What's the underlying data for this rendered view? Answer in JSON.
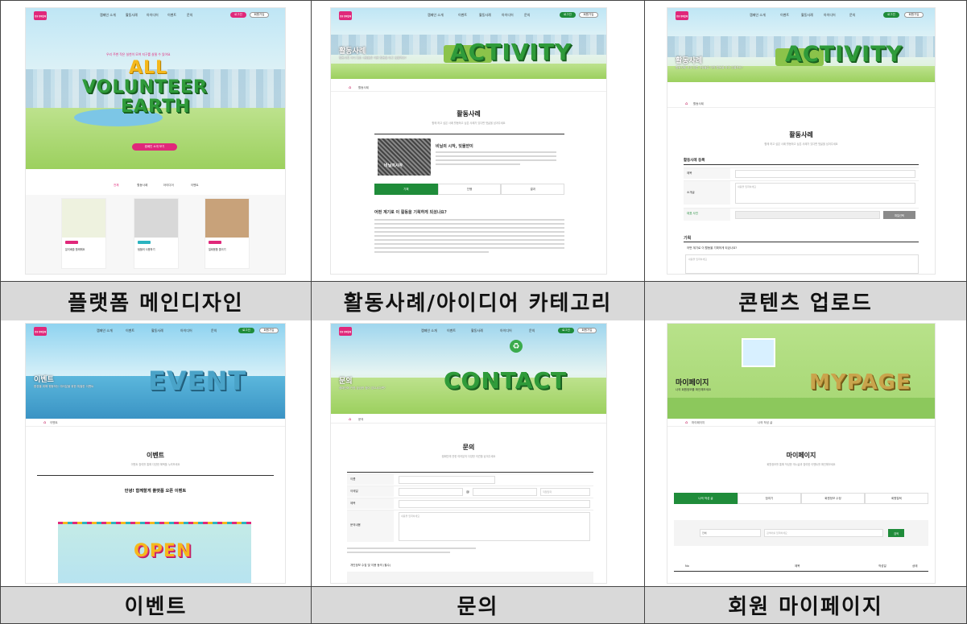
{
  "captions": [
    "플랫폼 메인디자인",
    "활동사례/아이디어 카테고리",
    "콘텐츠 업로드",
    "이벤트",
    "문의",
    "회원 마이페이지"
  ],
  "common": {
    "logo": "안녕 함께할께",
    "nav": [
      "캠페인 소개",
      "이벤트",
      "활동사례",
      "아이디어",
      "문의"
    ],
    "login": "로그인",
    "join": "회원가입",
    "home_icon": "home-icon"
  },
  "main": {
    "tagline": "우리 주변 작은 실천이 모여 지구를 살릴 수 있어요",
    "hero_lines": [
      "ALL",
      "VOLUNTEER",
      "EARTH"
    ],
    "cta": "캠페인 소개 보기",
    "tabs": [
      "전체",
      "활동사례",
      "아이디어",
      "이벤트"
    ],
    "cards": [
      {
        "tag": "활동사례",
        "title": "분리배출 함께해요"
      },
      {
        "tag": "아이디어",
        "title": "텀블러 사용하기"
      },
      {
        "tag": "활동사례",
        "title": "일회용품 줄이기"
      }
    ]
  },
  "activity": {
    "hero_title": "활동사례",
    "hero_sub": "활동사례 서식 다른 사람들은 어떤 활동을 하고 있을까요?",
    "hero_word": "ACTIVITY",
    "section": "활동사례",
    "section_sub": "함께 하고 싶은 사례 활동하고 싶은 사례가 있다면 댓글을 남겨주세요",
    "post_title": "비닐의 시작, 빗물받이",
    "thumb_text": "비닐의시작",
    "tabs": [
      "기획",
      "진행",
      "결과"
    ],
    "question": "어떤 계기로 이 활동을 기획하게 되셨나요?",
    "breadcrumb": "활동사례"
  },
  "upload": {
    "hero_title": "활동사례",
    "hero_sub": "활동사례 서식 다른 사람들은 어떤 활동을 하고 있을까요?",
    "hero_word": "ACTIVITY",
    "section": "활동사례",
    "section_sub": "함께 하고 싶은 사례 활동하고 싶은 사례가 있다면 댓글을 남겨주세요",
    "form_title": "활동사례 등록",
    "fields": [
      "제목",
      "소개글",
      "대표 사진"
    ],
    "placeholder": "내용을 입력하세요",
    "file_btn": "파일선택",
    "section2": "기획",
    "q": "어떤 계기로 이 활동을 기획하게 되셨나요?",
    "breadcrumb": "활동사례"
  },
  "event": {
    "hero_title": "이벤트",
    "hero_sub": "환경을 위해 행동하는 여러분을 위한 특별한 이벤트",
    "hero_word": "EVENT",
    "section": "이벤트",
    "section_sub": "이벤트 참여를 통해 다양한 혜택을 누려보세요",
    "post_title": "안녕! 함께할게 플랫폼 오픈 이벤트",
    "banner": "OPEN",
    "breadcrumb": "이벤트"
  },
  "contact": {
    "hero_title": "문의",
    "hero_sub": "캠페인에 관한 궁금한 점이 있으시다면?",
    "hero_word": "CONTACT",
    "section": "문의",
    "section_sub": "캠페인에 관한 여러분의 다양한 의견을 남겨주세요",
    "fields": [
      "이름",
      "이메일",
      "제목",
      "문의내용"
    ],
    "email_at": "@",
    "email_select": "직접입력",
    "placeholder": "내용을 입력하세요",
    "notice": "개인정보 수집 및 이용 동의 (필수)",
    "breadcrumb": "문의"
  },
  "mypage": {
    "hero_title": "마이페이지",
    "hero_sub": "나의 회원정보를 확인해보세요",
    "hero_word": "MYPAGE",
    "section": "마이페이지",
    "section_sub": "회원정보를 통해 작성한 게시글과 참여한 이벤트를 확인해보세요",
    "tabs": [
      "나의 작성 글",
      "참여기",
      "회원정보 수정",
      "회원탈퇴"
    ],
    "search_select": "전체",
    "search_placeholder": "검색어를 입력하세요",
    "search_btn": "검색",
    "cols": [
      "No",
      "제목",
      "작성일",
      "상태"
    ],
    "breadcrumb": "마이페이지",
    "breadcrumb2": "나의 작성 글"
  }
}
